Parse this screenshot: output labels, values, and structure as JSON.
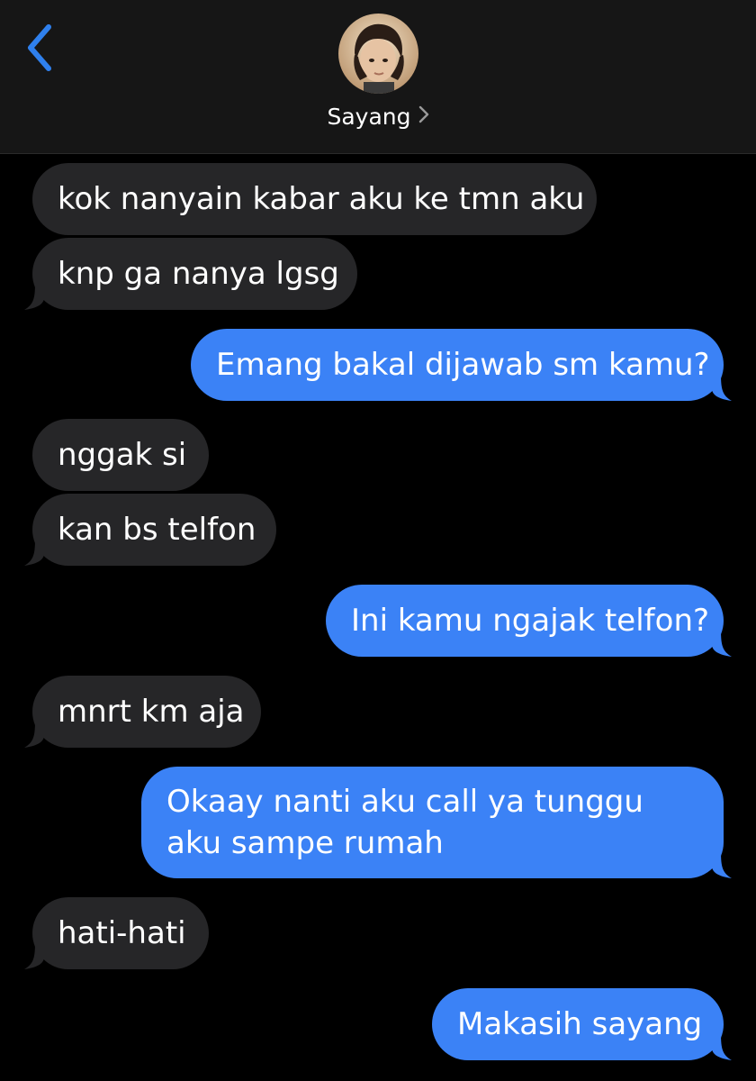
{
  "header": {
    "contact_name": "Sayang",
    "back_icon": "chevron-left-icon",
    "detail_icon": "chevron-right-icon",
    "accent_color": "#2f80ed"
  },
  "messages": [
    {
      "direction": "incoming",
      "text": "kok nanyain kabar aku ke tmn aku"
    },
    {
      "direction": "incoming",
      "text": "knp ga nanya lgsg"
    },
    {
      "direction": "outgoing",
      "text": "Emang bakal dijawab sm kamu?"
    },
    {
      "direction": "incoming",
      "text": "nggak si"
    },
    {
      "direction": "incoming",
      "text": "kan bs telfon"
    },
    {
      "direction": "outgoing",
      "text": "Ini kamu ngajak telfon?"
    },
    {
      "direction": "incoming",
      "text": "mnrt km aja"
    },
    {
      "direction": "outgoing",
      "text": "Okaay nanti aku call ya tunggu aku sampe rumah"
    },
    {
      "direction": "incoming",
      "text": "hati-hati"
    },
    {
      "direction": "outgoing",
      "text": "Makasih sayang"
    }
  ],
  "colors": {
    "incoming_bubble": "#262628",
    "outgoing_bubble": "#3b82f6",
    "background": "#000000",
    "header_background": "#161616"
  }
}
